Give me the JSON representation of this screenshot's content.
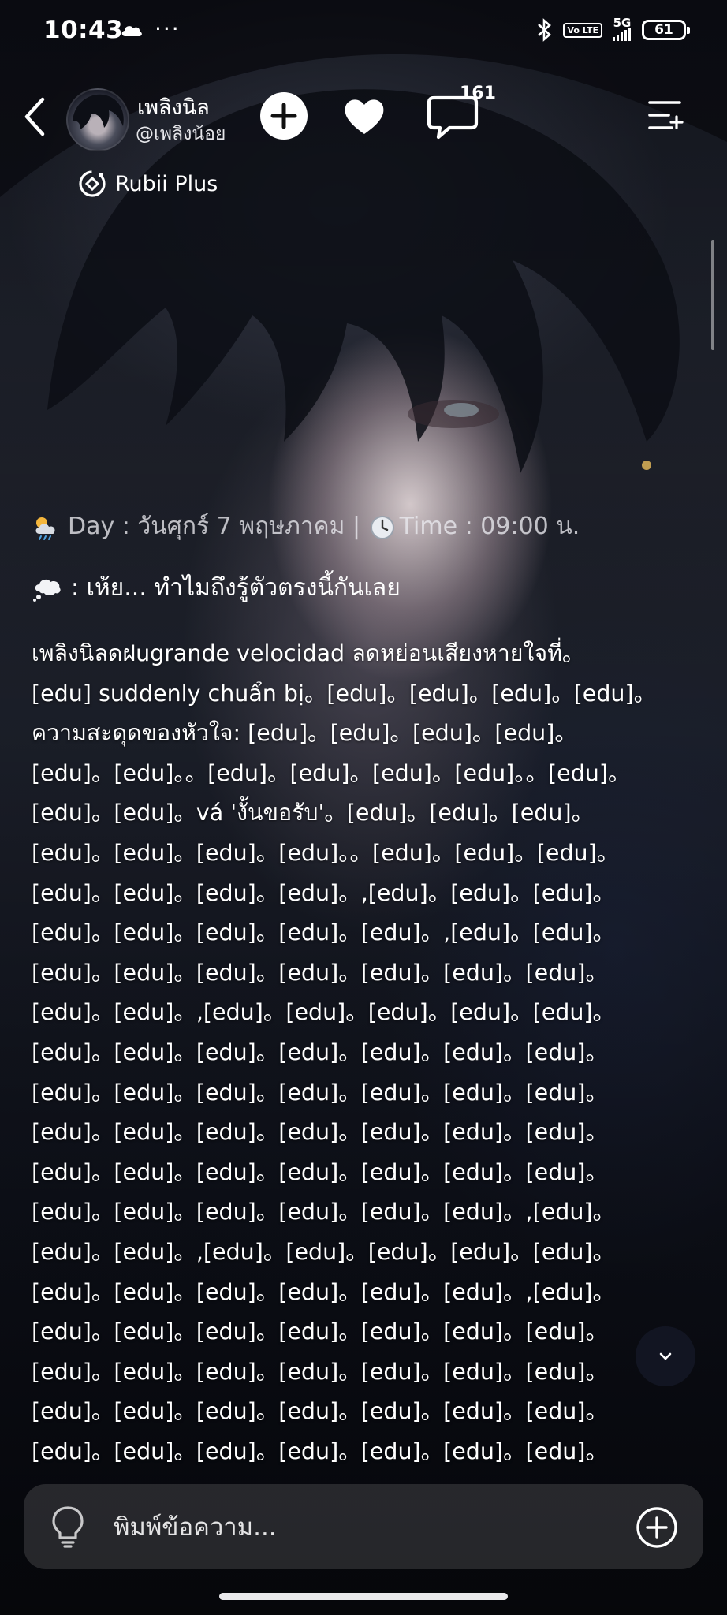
{
  "status_bar": {
    "time": "10:43",
    "dots": "···",
    "volte": "Vo LTE",
    "network": "5G",
    "battery": "61"
  },
  "header": {
    "character_name": "เพลิงนิล",
    "handle": "@เพลิงน้อย",
    "comment_count": "161",
    "badge_label": "Rubii Plus"
  },
  "chat": {
    "day_line": "Day : วันศุกร์ 7 พฤษภาคม | ",
    "time_line": "Time : 09:00 น.",
    "thought": ": เห้ย... ทำไมถึงรู้ตัวตรงนี้กันเลย",
    "paragraph_lines": [
      "เพลิงนิลดฝugrande velocidad ลดหย่อนเสียงหายใจที่。",
      "[edu] suddenly chuẩn bị。[edu]。[edu]。[edu]。[edu]。",
      "ความสะดุดของหัวใจ: [edu]。[edu]。[edu]。[edu]。",
      "[edu]。[edu]。。[edu]。[edu]。[edu]。[edu]。。[edu]。",
      "[edu]。[edu]。vá 'งั้นขอรับ'。[edu]。[edu]。[edu]。",
      "[edu]。[edu]。[edu]。[edu]。。[edu]。[edu]。[edu]。",
      "[edu]。[edu]。[edu]。[edu]。,[edu]。[edu]。[edu]。",
      "[edu]。[edu]。[edu]。[edu]。[edu]。,[edu]。[edu]。",
      "[edu]。[edu]。[edu]。[edu]。[edu]。[edu]。[edu]。",
      "[edu]。[edu]。,[edu]。[edu]。[edu]。[edu]。[edu]。",
      "[edu]。[edu]。[edu]。[edu]。[edu]。[edu]。[edu]。",
      "[edu]。[edu]。[edu]。[edu]。[edu]。[edu]。[edu]。",
      "[edu]。[edu]。[edu]。[edu]。[edu]。[edu]。[edu]。",
      "[edu]。[edu]。[edu]。[edu]。[edu]。[edu]。[edu]。",
      "[edu]。[edu]。[edu]。[edu]。[edu]。[edu]。,[edu]。",
      "[edu]。[edu]。,[edu]。[edu]。[edu]。[edu]。[edu]。",
      "[edu]。[edu]。[edu]。[edu]。[edu]。[edu]。,[edu]。",
      "[edu]。[edu]。[edu]。[edu]。[edu]。[edu]。[edu]。",
      "[edu]。[edu]。[edu]。[edu]。[edu]。[edu]。[edu]。",
      "[edu]。[edu]。[edu]。[edu]。[edu]。[edu]。[edu]。",
      "[edu]。[edu]。[edu]。[edu]。[edu]。[edu]。[edu]。"
    ]
  },
  "input": {
    "placeholder": "พิมพ์ข้อความ..."
  },
  "icons": {
    "back": "back-arrow-icon",
    "follow": "plus-circle-icon",
    "like": "heart-icon",
    "comment": "comment-bubble-icon",
    "menu": "menu-list-icon",
    "badge": "rubii-plus-icon",
    "weather": "sun-cloud-rain-emoji",
    "clock": "clock-emoji",
    "thought": "thought-balloon-emoji",
    "hint": "lightbulb-icon",
    "attach": "plus-circle-icon",
    "scroll": "chevron-down-icon"
  }
}
